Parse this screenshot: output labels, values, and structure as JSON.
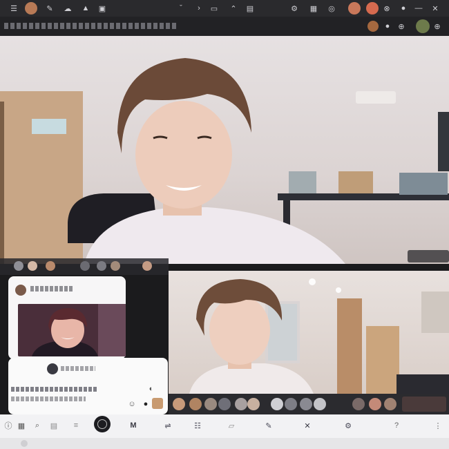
{
  "topbar": {
    "icons": [
      "menu-icon",
      "avatar-icon",
      "text-icon",
      "cloud-icon",
      "triangle-icon",
      "image-icon",
      "caret-icon",
      "arrow-icon",
      "screen-icon",
      "chevron-icon",
      "camera-icon",
      "settings-icon",
      "chat-icon",
      "globe-icon",
      "record-icon",
      "shield-icon",
      "more-icon",
      "search-icon"
    ]
  },
  "titlebar": {
    "title": "",
    "participant_count": ""
  },
  "main_video": {
    "participant": ""
  },
  "sub_video": {
    "participant": ""
  },
  "chat_panel": {
    "sender": "",
    "message": "",
    "reply": ""
  },
  "bottombar": {
    "items": [
      "",
      "",
      "",
      "",
      "",
      "",
      "",
      "",
      "",
      ""
    ]
  },
  "colors": {
    "accent": "#3a3a40",
    "bar_dark": "#2a2a2d",
    "bar_light": "#f2f2f4"
  }
}
